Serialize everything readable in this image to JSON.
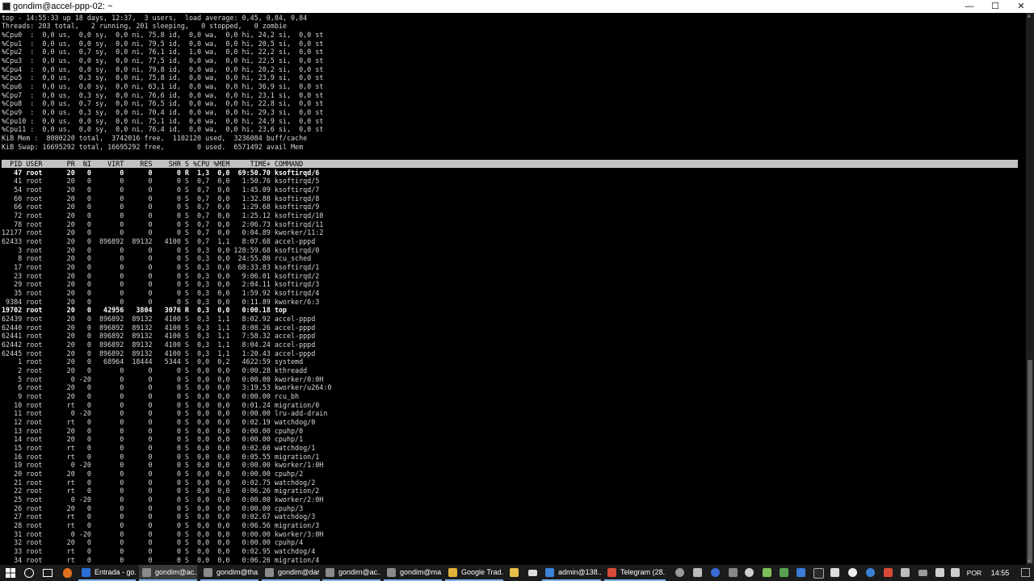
{
  "window": {
    "title": "gondim@accel-ppp-02: ~",
    "minimize_glyph": "—",
    "maximize_glyph": "☐",
    "close_glyph": "✕"
  },
  "terminal": {
    "summary": [
      "top - 14:55:33 up 18 days, 12:37,  3 users,  load average: 0,45, 0,84, 0,84",
      "Threads: 203 total,   2 running, 201 sleeping,   0 stopped,   0 zombie",
      "%Cpu0  :  0,0 us,  0,0 sy,  0,0 ni, 75,8 id,  0,0 wa,  0,0 hi, 24,2 si,  0,0 st",
      "%Cpu1  :  0,0 us,  0,0 sy,  0,0 ni, 79,5 id,  0,0 wa,  0,0 hi, 20,5 si,  0,0 st",
      "%Cpu2  :  0,0 us,  0,7 sy,  0,0 ni, 76,1 id,  1,0 wa,  0,0 hi, 22,2 si,  0,0 st",
      "%Cpu3  :  0,0 us,  0,0 sy,  0,0 ni, 77,5 id,  0,0 wa,  0,0 hi, 22,5 si,  0,0 st",
      "%Cpu4  :  0,0 us,  0,0 sy,  0,0 ni, 79,8 id,  0,0 wa,  0,0 hi, 20,2 si,  0,0 st",
      "%Cpu5  :  0,0 us,  0,3 sy,  0,0 ni, 75,8 id,  0,0 wa,  0,0 hi, 23,9 si,  0,0 st",
      "%Cpu6  :  0,0 us,  0,0 sy,  0,0 ni, 63,1 id,  0,0 wa,  0,0 hi, 36,9 si,  0,0 st",
      "%Cpu7  :  0,0 us,  0,3 sy,  0,0 ni, 76,6 id,  0,0 wa,  0,0 hi, 23,1 si,  0,0 st",
      "%Cpu8  :  0,0 us,  0,7 sy,  0,0 ni, 76,5 id,  0,0 wa,  0,0 hi, 22,8 si,  0,0 st",
      "%Cpu9  :  0,0 us,  0,3 sy,  0,0 ni, 70,4 id,  0,0 wa,  0,0 hi, 29,3 si,  0,0 st",
      "%Cpu10 :  0,0 us,  0,0 sy,  0,0 ni, 75,1 id,  0,0 wa,  0,0 hi, 24,9 si,  0,0 st",
      "%Cpu11 :  0,0 us,  0,0 sy,  0,0 ni, 76,4 id,  0,0 wa,  0,0 hi, 23,6 si,  0,0 st",
      "KiB Mem :  8080220 total,  3742016 free,  1102120 used,  3236084 buff/cache",
      "KiB Swap: 16695292 total, 16695292 free,        0 used.  6571492 avail Mem"
    ],
    "column_header": "  PID USER      PR  NI    VIRT    RES    SHR S %CPU %MEM     TIME+ COMMAND",
    "processes": [
      "   47 root      20   0       0      0      0 R  1,3  0,0  69:50.70 ksoftirqd/6",
      "   41 root      20   0       0      0      0 S  0,7  0,0   1:50.76 ksoftirqd/5",
      "   54 root      20   0       0      0      0 S  0,7  0,0   1:45.09 ksoftirqd/7",
      "   60 root      20   0       0      0      0 S  0,7  0,0   1:32.88 ksoftirqd/8",
      "   66 root      20   0       0      0      0 S  0,7  0,0   1:29.68 ksoftirqd/9",
      "   72 root      20   0       0      0      0 S  0,7  0,0   1:25.12 ksoftirqd/10",
      "   78 root      20   0       0      0      0 S  0,7  0,0   2:06.73 ksoftirqd/11",
      "12177 root      20   0       0      0      0 S  0,7  0,0   0:04.89 kworker/11:2",
      "62433 root      20   0  896892  89132   4100 S  0,7  1,1   8:07.68 accel-pppd",
      "    3 root      20   0       0      0      0 S  0,3  0,0 128:59.68 ksoftirqd/0",
      "    8 root      20   0       0      0      0 S  0,3  0,0  24:55.80 rcu_sched",
      "   17 root      20   0       0      0      0 S  0,3  0,0  68:33.83 ksoftirqd/1",
      "   23 root      20   0       0      0      0 S  0,3  0,0   9:06.01 ksoftirqd/2",
      "   29 root      20   0       0      0      0 S  0,3  0,0   2:04.11 ksoftirqd/3",
      "   35 root      20   0       0      0      0 S  0,3  0,0   1:59.92 ksoftirqd/4",
      " 9384 root      20   0       0      0      0 S  0,3  0,0   0:11.89 kworker/6:3",
      "19702 root      20   0   42956   3804   3076 R  0,3  0,0   0:00.18 top",
      "62439 root      20   0  896892  89132   4100 S  0,3  1,1   8:02.92 accel-pppd",
      "62440 root      20   0  896892  89132   4100 S  0,3  1,1   8:08.26 accel-pppd",
      "62441 root      20   0  896892  89132   4100 S  0,3  1,1   7:58.32 accel-pppd",
      "62442 root      20   0  896892  89132   4100 S  0,3  1,1   8:04.24 accel-pppd",
      "62445 root      20   0  896892  89132   4100 S  0,3  1,1   1:20.43 accel-pppd",
      "    1 root      20   0   68964  18444   5344 S  0,0  0,2   4622:59 systemd",
      "    2 root      20   0       0      0      0 S  0,0  0,0   0:00.28 kthreadd",
      "    5 root       0 -20       0      0      0 S  0,0  0,0   0:00.00 kworker/0:0H",
      "    6 root      20   0       0      0      0 S  0,0  0,0   3:19.53 kworker/u264:0",
      "    9 root      20   0       0      0      0 S  0,0  0,0   0:00.00 rcu_bh",
      "   10 root      rt   0       0      0      0 S  0,0  0,0   0:01.24 migration/0",
      "   11 root       0 -20       0      0      0 S  0,0  0,0   0:00.00 lru-add-drain",
      "   12 root      rt   0       0      0      0 S  0,0  0,0   0:02.19 watchdog/0",
      "   13 root      20   0       0      0      0 S  0,0  0,0   0:00.00 cpuhp/0",
      "   14 root      20   0       0      0      0 S  0,0  0,0   0:00.00 cpuhp/1",
      "   15 root      rt   0       0      0      0 S  0,0  0,0   0:02.60 watchdog/1",
      "   16 root      rt   0       0      0      0 S  0,0  0,0   0:05.55 migration/1",
      "   19 root       0 -20       0      0      0 S  0,0  0,0   0:00.00 kworker/1:0H",
      "   20 root      20   0       0      0      0 S  0,0  0,0   0:00.00 cpuhp/2",
      "   21 root      rt   0       0      0      0 S  0,0  0,0   0:02.75 watchdog/2",
      "   22 root      rt   0       0      0      0 S  0,0  0,0   0:06.26 migration/2",
      "   25 root       0 -20       0      0      0 S  0,0  0,0   0:00.00 kworker/2:0H",
      "   26 root      20   0       0      0      0 S  0,0  0,0   0:00.00 cpuhp/3",
      "   27 root      rt   0       0      0      0 S  0,0  0,0   0:02.67 watchdog/3",
      "   28 root      rt   0       0      0      0 S  0,0  0,0   0:06.56 migration/3",
      "   31 root       0 -20       0      0      0 S  0,0  0,0   0:00.00 kworker/3:0H",
      "   32 root      20   0       0      0      0 S  0,0  0,0   0:00.00 cpuhp/4",
      "   33 root      rt   0       0      0      0 S  0,0  0,0   0:02.95 watchdog/4",
      "   34 root      rt   0       0      0      0 S  0,0  0,0   0:06.26 migration/4"
    ],
    "highlighted_rows": [
      0,
      16
    ]
  },
  "taskbar": {
    "tasks": [
      {
        "label": "Entrada - go...",
        "icon": "browser-icon",
        "color": "#2b6fd6",
        "active": false
      },
      {
        "label": "gondim@ac...",
        "icon": "putty-icon",
        "color": "#8a8a8a",
        "active": true
      },
      {
        "label": "gondim@tha...",
        "icon": "putty-icon",
        "color": "#8a8a8a",
        "active": false
      },
      {
        "label": "gondim@dar...",
        "icon": "putty-icon",
        "color": "#8a8a8a",
        "active": false
      },
      {
        "label": "gondim@ac...",
        "icon": "putty-icon",
        "color": "#8a8a8a",
        "active": false
      },
      {
        "label": "gondim@ma...",
        "icon": "putty-icon",
        "color": "#8a8a8a",
        "active": false
      },
      {
        "label": "Google Trad...",
        "icon": "chrome-icon",
        "color": "#e0b43a",
        "active": false
      },
      {
        "label": "admin@138....",
        "icon": "winbox-icon",
        "color": "#3b82d6",
        "active": false
      },
      {
        "label": "Telegram (28...",
        "icon": "telegram-icon",
        "color": "#d84a3a",
        "active": false
      }
    ],
    "language": "POR",
    "clock": "14:55"
  }
}
